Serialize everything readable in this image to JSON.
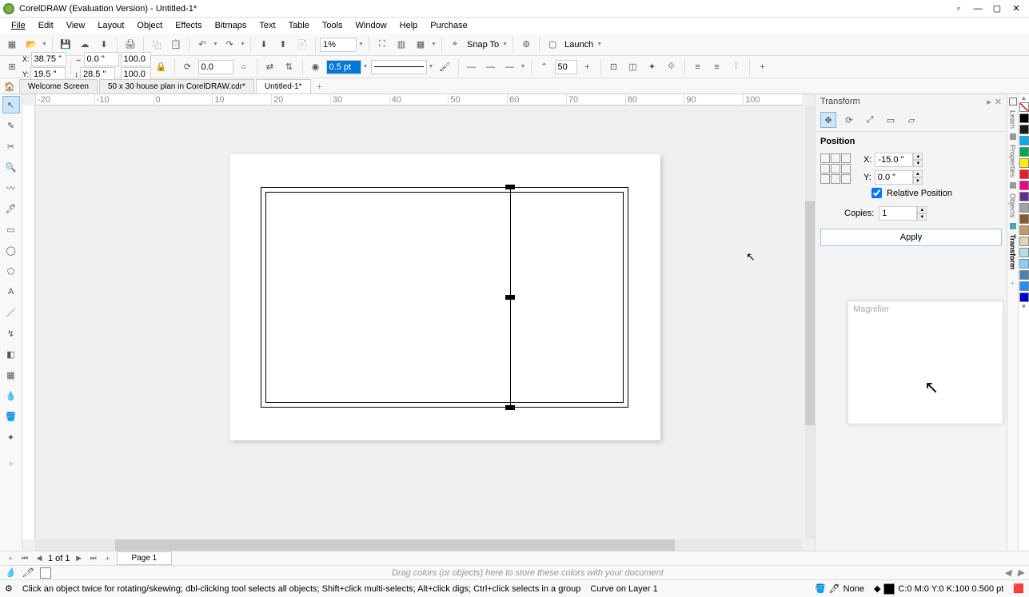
{
  "app": {
    "title": "CorelDRAW (Evaluation Version) - Untitled-1*"
  },
  "menu": [
    "File",
    "Edit",
    "View",
    "Layout",
    "Object",
    "Effects",
    "Bitmaps",
    "Text",
    "Table",
    "Tools",
    "Window",
    "Help",
    "Purchase"
  ],
  "toolbar1": {
    "zoom": "1%",
    "snap": "Snap To",
    "launch": "Launch"
  },
  "toolbar2": {
    "x": "38.75 \"",
    "y": "19.5 \"",
    "w": "0.0 \"",
    "h": "28.5 \"",
    "sx": "100.0",
    "sy": "100.0",
    "rot": "0.0",
    "outline": "0.5 pt",
    "round": "50"
  },
  "tabs": {
    "t1": "Welcome Screen",
    "t2": "50 x 30 house plan in CorelDRAW.cdr*",
    "t3": "Untitled-1*"
  },
  "ruler": [
    "-20",
    "-10",
    "0",
    "10",
    "20",
    "30",
    "40",
    "50",
    "60",
    "70",
    "80",
    "90",
    "100"
  ],
  "docker": {
    "title": "Transform",
    "position": "Position",
    "x_label": "X:",
    "y_label": "Y:",
    "x": "-15.0 \"",
    "y": "0.0 \"",
    "relative": "Relative Position",
    "copies_label": "Copies:",
    "copies": "1",
    "apply": "Apply",
    "magnifier": "Magnifier"
  },
  "side_tabs": [
    "Learn",
    "Properties",
    "Objects",
    "Transform"
  ],
  "colors": [
    "#ffffff",
    "#000000",
    "#1a1a1a",
    "#00aeef",
    "#00a651",
    "#fff200",
    "#ed1c24",
    "#ec008c",
    "#662d91",
    "#a3a3a3",
    "#8b5a2b",
    "#c49a6c",
    "#e6d2b5",
    "#b0e0e6",
    "#87cefa",
    "#4682b4",
    "#1e90ff",
    "#0000cd"
  ],
  "pagenav": {
    "info": "1 of 1",
    "page": "Page 1"
  },
  "palette_hint": "Drag colors (or objects) here to store these colors with your document",
  "status": {
    "hint": "Click an object twice for rotating/skewing; dbl-clicking tool selects all objects; Shift+click multi-selects; Alt+click digs; Ctrl+click selects in a group",
    "layer": "Curve on Layer 1",
    "fill": "None",
    "cmyk": "C:0 M:0 Y:0 K:100  0.500 pt"
  }
}
